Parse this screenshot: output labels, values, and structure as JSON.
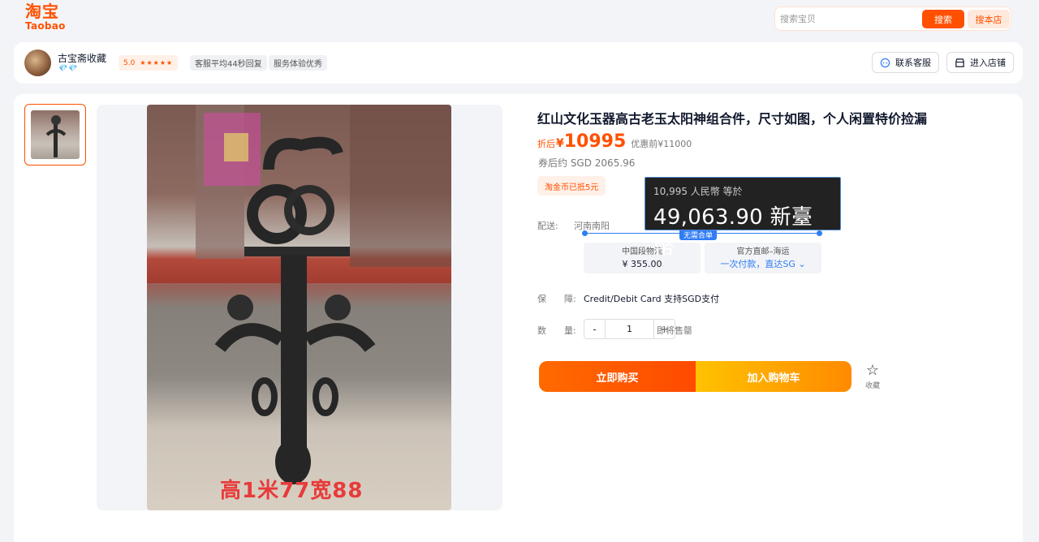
{
  "header": {
    "logo_cn": "淘宝",
    "logo_en": "Taobao",
    "search_placeholder": "搜索宝贝",
    "search_button": "搜索",
    "store_search_button": "搜本店"
  },
  "shop": {
    "name": "古宝斋收藏",
    "level_badge": "💎💎",
    "rating": "5.0",
    "stars": "★★★★★",
    "tags": [
      "客服平均44秒回复",
      "服务体验优秀"
    ],
    "contact_label": "联系客服",
    "enter_label": "进入店铺"
  },
  "product": {
    "title": "红山文化玉器高古老玉太阳神组合件，尺寸如图，个人闲置特价捡漏",
    "image_caption": "高1米77宽88",
    "price_label": "折后",
    "price_currency": "¥",
    "price": "10995",
    "original_price": "优惠前¥11000",
    "sgd_price": "券后约 SGD 2065.96",
    "coin_tag": "淘金币已抵5元"
  },
  "shipping": {
    "label": "配送:",
    "origin": "河南南阳",
    "no_merge": "无需合单",
    "options": [
      {
        "title": "中国段物流",
        "value": "¥ 355.00"
      },
      {
        "title": "官方直邮–海运",
        "value": "一次付款，直达SG"
      }
    ]
  },
  "guarantee": {
    "label_1": "保",
    "label_2": "障:",
    "text": "Credit/Debit Card 支持SGD支付"
  },
  "quantity": {
    "label_1": "数",
    "label_2": "量:",
    "minus": "-",
    "value": "1",
    "plus": "+",
    "note": "即将售罄"
  },
  "actions": {
    "buy_now": "立即购买",
    "add_cart": "加入购物车",
    "favorite": "收藏"
  },
  "tooltip": {
    "line1": "10,995 人民幣 等於",
    "line2": "49,063.90 新臺幣"
  },
  "colors": {
    "brand": "#ff5000",
    "link_blue": "#2f7cf6"
  }
}
